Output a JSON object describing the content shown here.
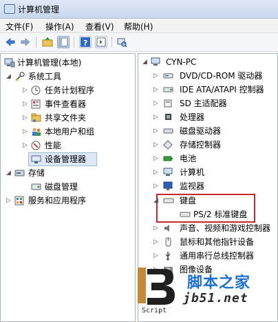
{
  "window": {
    "title": "计算机管理"
  },
  "menu": [
    {
      "label": "文件(F)"
    },
    {
      "label": "操作(A)"
    },
    {
      "label": "查看(V)"
    },
    {
      "label": "帮助(H)"
    }
  ],
  "left_tree": [
    {
      "label": "计算机管理(本地)",
      "icon": "computer-management-icon"
    },
    {
      "label": "系统工具",
      "icon": "system-tools-icon"
    },
    {
      "label": "任务计划程序",
      "icon": "task-scheduler-icon"
    },
    {
      "label": "事件查看器",
      "icon": "event-viewer-icon"
    },
    {
      "label": "共享文件夹",
      "icon": "shared-folder-icon"
    },
    {
      "label": "本地用户和组",
      "icon": "users-groups-icon"
    },
    {
      "label": "性能",
      "icon": "performance-icon"
    },
    {
      "label": "设备管理器",
      "icon": "device-manager-icon"
    },
    {
      "label": "存储",
      "icon": "storage-icon"
    },
    {
      "label": "磁盘管理",
      "icon": "disk-management-icon"
    },
    {
      "label": "服务和应用程序",
      "icon": "services-apps-icon"
    }
  ],
  "device_tree": {
    "root": {
      "label": "CYN-PC",
      "icon": "computer-icon"
    },
    "items": [
      {
        "label": "DVD/CD-ROM 驱动器",
        "icon": "dvd-drive-icon"
      },
      {
        "label": "IDE ATA/ATAPI 控制器",
        "icon": "ide-controller-icon"
      },
      {
        "label": "SD 主适配器",
        "icon": "sd-adapter-icon"
      },
      {
        "label": "处理器",
        "icon": "processor-icon"
      },
      {
        "label": "磁盘驱动器",
        "icon": "disk-drive-icon"
      },
      {
        "label": "存储控制器",
        "icon": "storage-controller-icon"
      },
      {
        "label": "电池",
        "icon": "battery-icon"
      },
      {
        "label": "计算机",
        "icon": "computer-icon"
      },
      {
        "label": "监视器",
        "icon": "monitor-icon"
      },
      {
        "label": "键盘",
        "icon": "keyboard-icon"
      },
      {
        "label": "PS/2 标准键盘",
        "icon": "keyboard-icon"
      },
      {
        "label": "声音、视频和游戏控制器",
        "icon": "sound-icon"
      },
      {
        "label": "鼠标和其他指针设备",
        "icon": "mouse-icon"
      },
      {
        "label": "通用串行总线控制器",
        "icon": "usb-icon"
      },
      {
        "label": "图像设备",
        "icon": "imaging-icon"
      }
    ]
  },
  "watermark": {
    "cn_text": "脚本之家",
    "url": "jb51.net",
    "script_label": "Script"
  },
  "colors": {
    "highlight_box": "#c6262e",
    "selection": "#dde8f6"
  }
}
